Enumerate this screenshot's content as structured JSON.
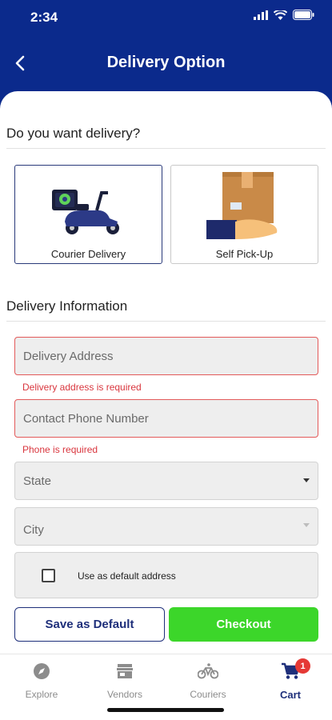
{
  "status": {
    "time": "2:34"
  },
  "header": {
    "title": "Delivery Option",
    "back_icon": "chevron-left-icon"
  },
  "delivery_question": "Do you want delivery?",
  "options": [
    {
      "label": "Courier Delivery",
      "icon": "scooter-icon",
      "selected": true
    },
    {
      "label": "Self Pick-Up",
      "icon": "package-hand-icon",
      "selected": false
    }
  ],
  "info": {
    "title": "Delivery Information",
    "address": {
      "placeholder": "Delivery Address",
      "error": "Delivery address is required"
    },
    "phone": {
      "placeholder": "Contact Phone Number",
      "error": "Phone is required"
    },
    "state": {
      "placeholder": "State"
    },
    "city": {
      "placeholder": "City"
    },
    "default_label": "Use as default address"
  },
  "buttons": {
    "save": "Save as Default",
    "checkout": "Checkout"
  },
  "tabs": [
    {
      "label": "Explore",
      "icon": "compass-icon"
    },
    {
      "label": "Vendors",
      "icon": "store-icon"
    },
    {
      "label": "Couriers",
      "icon": "bicycle-icon"
    },
    {
      "label": "Cart",
      "icon": "cart-icon",
      "badge": "1",
      "active": true
    }
  ],
  "colors": {
    "primary": "#0b2a8c",
    "accent": "#3cd62a",
    "error": "#d9363e",
    "badge": "#e53935"
  }
}
